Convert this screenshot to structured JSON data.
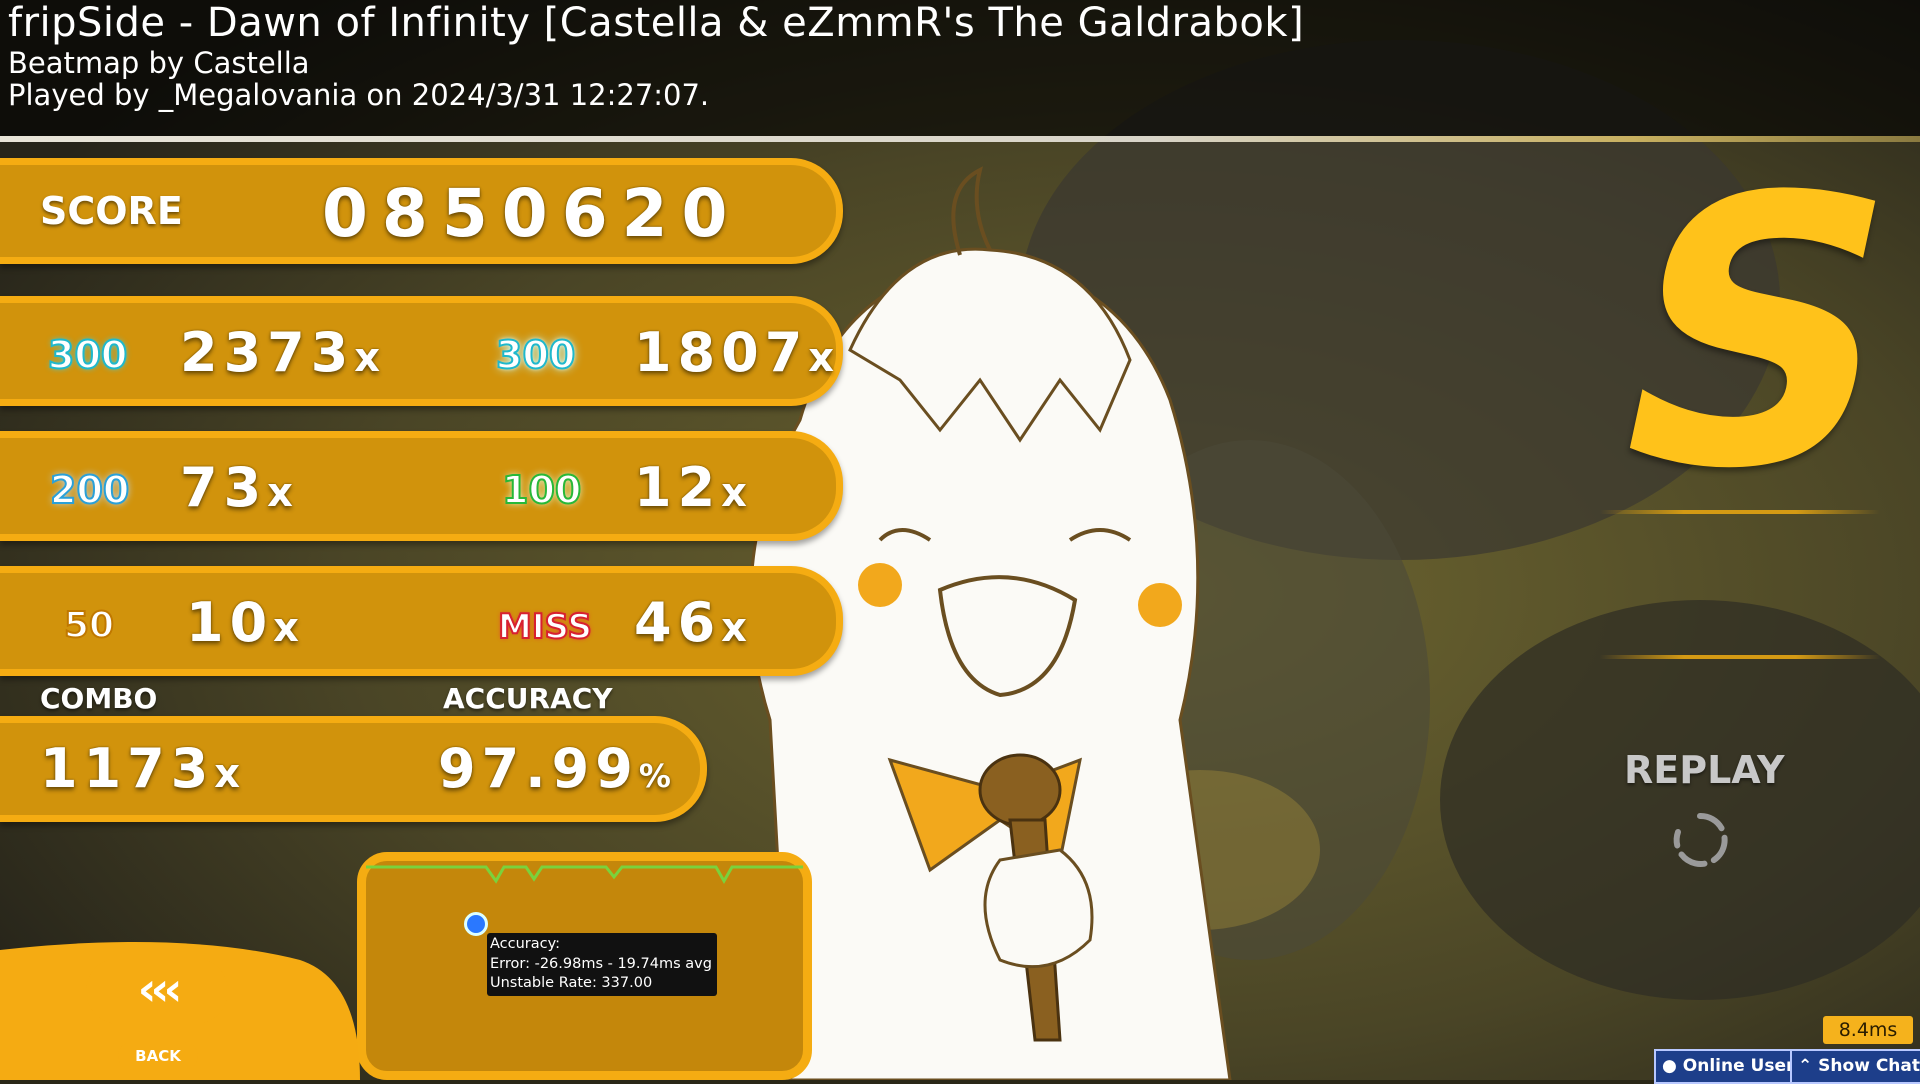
{
  "header": {
    "title": "fripSide - Dawn of Infinity [Castella & eZmmR's The Galdrabok]",
    "creator": "Beatmap by Castella",
    "played_by": "Played by _Megalovania on 2024/3/31 12:27:07."
  },
  "score": {
    "label": "SCORE",
    "value": "0850620"
  },
  "hits": {
    "h300": {
      "icon": "300",
      "count": "2373",
      "suffix": "x"
    },
    "geki": {
      "icon": "300",
      "count": "1807",
      "suffix": "x"
    },
    "h200": {
      "icon": "200",
      "count": "73",
      "suffix": "x"
    },
    "katu": {
      "icon": "100",
      "count": "12",
      "suffix": "x"
    },
    "h50": {
      "icon": "50",
      "count": "10",
      "suffix": "x"
    },
    "miss": {
      "icon": "MISS",
      "count": "46",
      "suffix": "x"
    }
  },
  "combo": {
    "label": "COMBO",
    "value": "1173",
    "suffix": "x"
  },
  "accuracy": {
    "label": "ACCURACY",
    "value": "97.99",
    "suffix": "%"
  },
  "rank": "S",
  "replay_label": "REPLAY",
  "tooltip": {
    "line1": "Accuracy:",
    "line2": "Error: -26.98ms - 19.74ms avg",
    "line3": "Unstable Rate: 337.00"
  },
  "back": {
    "arrows": "‹‹‹",
    "label": "BACK"
  },
  "frame_time": "8.4ms",
  "bottom_bar": {
    "online_users": "Online Users",
    "show_chat": "Show Chat"
  },
  "colors": {
    "panel": "#d1930c",
    "panel_border": "#f5ac12",
    "rank": "#ffc21a",
    "hit300": "#3fd0e0",
    "miss": "#e0303a"
  }
}
